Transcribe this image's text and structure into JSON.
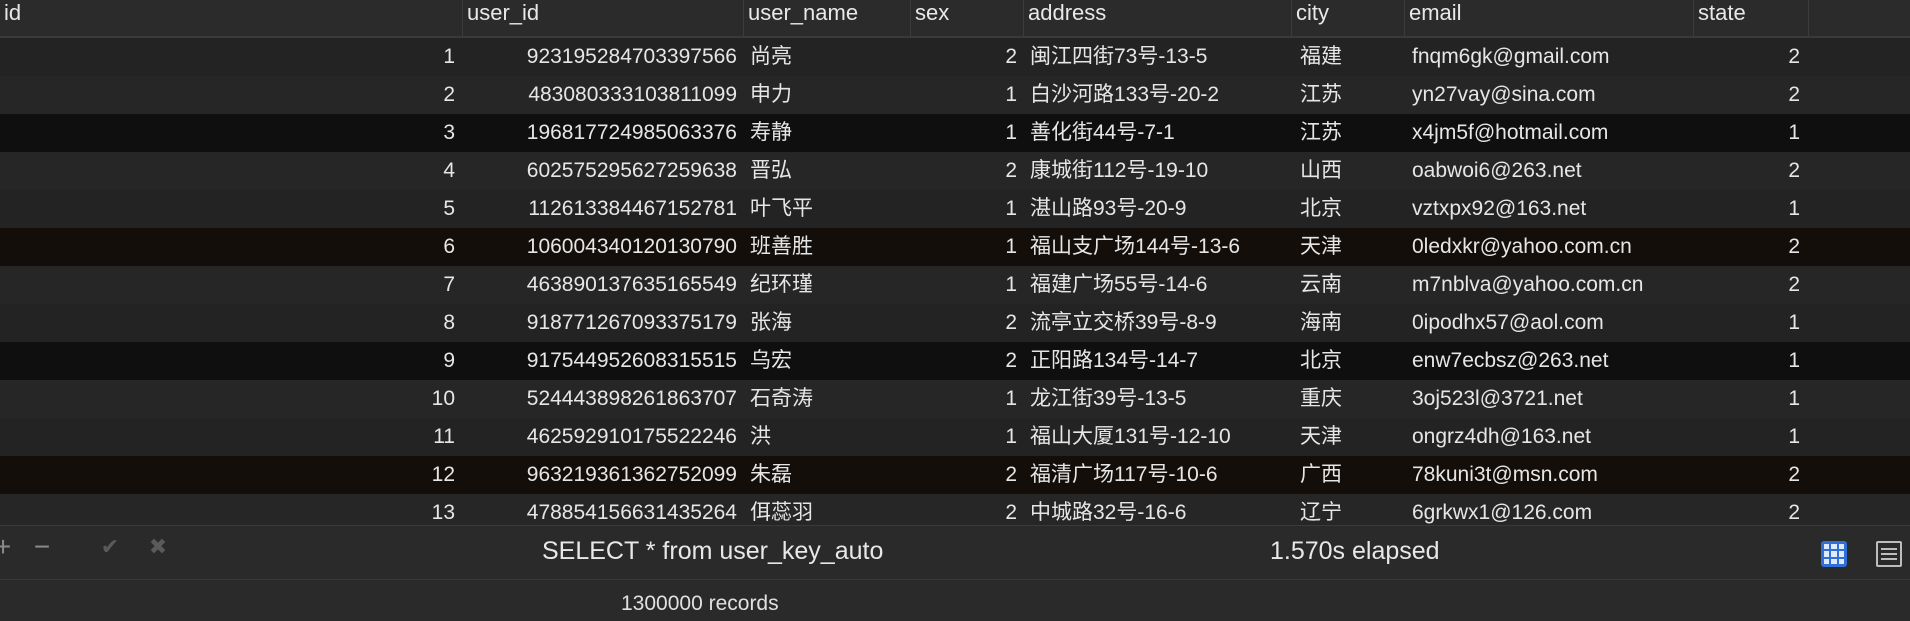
{
  "columns": [
    {
      "key": "id",
      "label": "id"
    },
    {
      "key": "user_id",
      "label": "user_id"
    },
    {
      "key": "user_name",
      "label": "user_name"
    },
    {
      "key": "sex",
      "label": "sex"
    },
    {
      "key": "address",
      "label": "address"
    },
    {
      "key": "city",
      "label": "city"
    },
    {
      "key": "email",
      "label": "email"
    },
    {
      "key": "state",
      "label": "state"
    }
  ],
  "rows": [
    {
      "id": "1",
      "user_id": "923195284703397566",
      "user_name": "尚亮",
      "sex": "2",
      "address": "闽江四街73号-13-5",
      "city": "福建",
      "email": "fnqm6gk@gmail.com",
      "state": "2"
    },
    {
      "id": "2",
      "user_id": "483080333103811099",
      "user_name": "申力",
      "sex": "1",
      "address": "白沙河路133号-20-2",
      "city": "江苏",
      "email": "yn27vay@sina.com",
      "state": "2"
    },
    {
      "id": "3",
      "user_id": "196817724985063376",
      "user_name": "寿静",
      "sex": "1",
      "address": "善化街44号-7-1",
      "city": "江苏",
      "email": "x4jm5f@hotmail.com",
      "state": "1"
    },
    {
      "id": "4",
      "user_id": "602575295627259638",
      "user_name": "晋弘",
      "sex": "2",
      "address": "康城街112号-19-10",
      "city": "山西",
      "email": "oabwoi6@263.net",
      "state": "2"
    },
    {
      "id": "5",
      "user_id": "112613384467152781",
      "user_name": "叶飞平",
      "sex": "1",
      "address": "湛山路93号-20-9",
      "city": "北京",
      "email": "vztxpx92@163.net",
      "state": "1"
    },
    {
      "id": "6",
      "user_id": "106004340120130790",
      "user_name": "班善胜",
      "sex": "1",
      "address": "福山支广场144号-13-6",
      "city": "天津",
      "email": "0ledxkr@yahoo.com.cn",
      "state": "2"
    },
    {
      "id": "7",
      "user_id": "463890137635165549",
      "user_name": "纪环瑾",
      "sex": "1",
      "address": "福建广场55号-14-6",
      "city": "云南",
      "email": "m7nblva@yahoo.com.cn",
      "state": "2"
    },
    {
      "id": "8",
      "user_id": "918771267093375179",
      "user_name": "张海",
      "sex": "2",
      "address": "流亭立交桥39号-8-9",
      "city": "海南",
      "email": "0ipodhx57@aol.com",
      "state": "1"
    },
    {
      "id": "9",
      "user_id": "917544952608315515",
      "user_name": "乌宏",
      "sex": "2",
      "address": "正阳路134号-14-7",
      "city": "北京",
      "email": "enw7ecbsz@263.net",
      "state": "1"
    },
    {
      "id": "10",
      "user_id": "524443898261863707",
      "user_name": "石奇涛",
      "sex": "1",
      "address": "龙江街39号-13-5",
      "city": "重庆",
      "email": "3oj523l@3721.net",
      "state": "1"
    },
    {
      "id": "11",
      "user_id": "462592910175522246",
      "user_name": "洪",
      "sex": "1",
      "address": "福山大厦131号-12-10",
      "city": "天津",
      "email": "ongrz4dh@163.net",
      "state": "1"
    },
    {
      "id": "12",
      "user_id": "963219361362752099",
      "user_name": "朱磊",
      "sex": "2",
      "address": "福清广场117号-10-6",
      "city": "广西",
      "email": "78kuni3t@msn.com",
      "state": "2"
    },
    {
      "id": "13",
      "user_id": "478854156631435264",
      "user_name": "佴蕊羽",
      "sex": "2",
      "address": "中城路32号-16-6",
      "city": "辽宁",
      "email": "6grkwx1@126.com",
      "state": "2"
    }
  ],
  "footer": {
    "query": "SELECT * from user_key_auto",
    "elapsed": "1.570s elapsed",
    "records": "1300000 records"
  },
  "toolbar": {
    "add_icon": "+",
    "remove_icon": "−",
    "confirm_icon": "✔",
    "cancel_icon": "✖"
  },
  "icons": [
    "add-icon",
    "remove-icon",
    "check-icon",
    "close-icon",
    "grid-view-icon",
    "form-view-icon"
  ]
}
